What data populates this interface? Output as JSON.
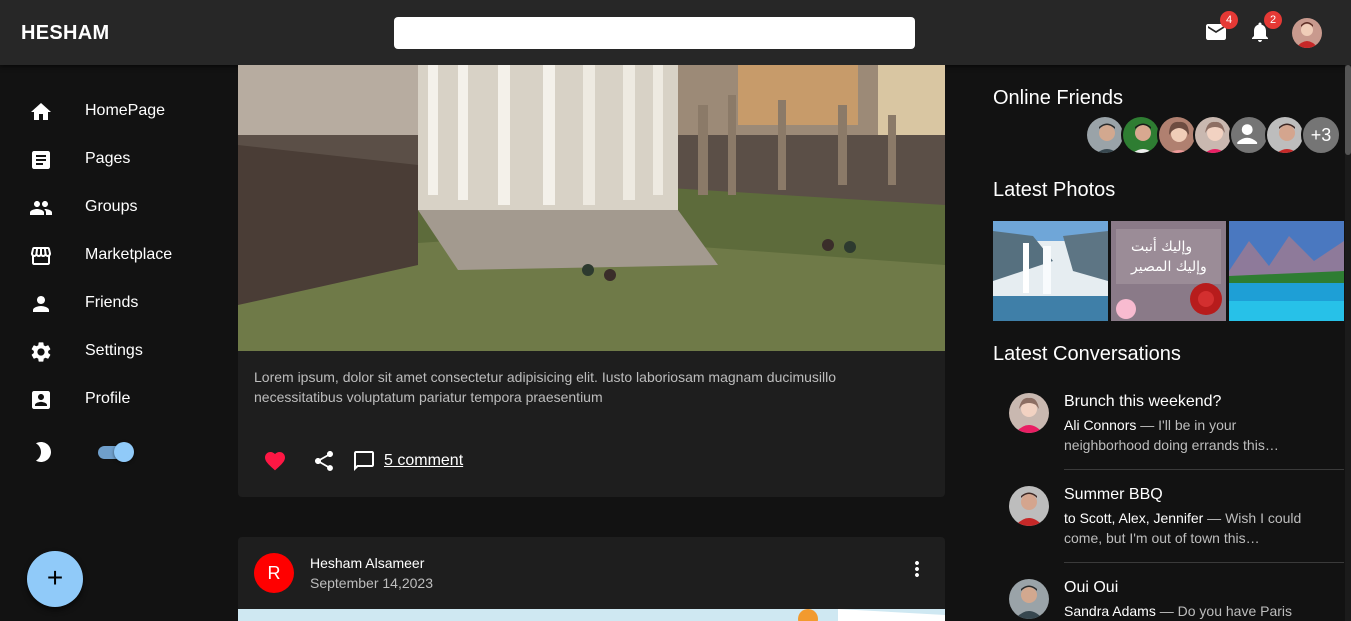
{
  "appbar": {
    "brand": "HESHAM",
    "search": {
      "value": "",
      "placeholder": ""
    },
    "mail_badge": "4",
    "notifications_badge": "2"
  },
  "sidebar": {
    "items": [
      {
        "label": "HomePage",
        "icon": "home-icon"
      },
      {
        "label": "Pages",
        "icon": "article-icon"
      },
      {
        "label": "Groups",
        "icon": "group-icon"
      },
      {
        "label": "Marketplace",
        "icon": "storefront-icon"
      },
      {
        "label": "Friends",
        "icon": "person-icon"
      },
      {
        "label": "Settings",
        "icon": "settings-icon"
      },
      {
        "label": "Profile",
        "icon": "account-box-icon"
      }
    ],
    "dark_mode": true,
    "fab_label": "+"
  },
  "feed": {
    "post1": {
      "text": "Lorem ipsum, dolor sit amet consectetur adipisicing elit. Iusto laboriosam magnam ducimusillo necessitatibus voluptatum pariatur tempora praesentium",
      "comment_link": "5 comment"
    },
    "post2": {
      "avatar_letter": "R",
      "author": "Hesham Alsameer",
      "date": "September 14,2023"
    }
  },
  "right": {
    "online_title": "Online Friends",
    "online_more": "+3",
    "photos_title": "Latest Photos",
    "conversations_title": "Latest Conversations",
    "conversations": [
      {
        "title": "Brunch this weekend?",
        "from": "Ali Connors",
        "snippet": " — I'll be in your neighborhood doing errands this…"
      },
      {
        "title": "Summer BBQ",
        "from": "to Scott, Alex, Jennifer",
        "snippet": " — Wish I could come, but I'm out of town this…"
      },
      {
        "title": "Oui Oui",
        "from": "Sandra Adams",
        "snippet": " — Do you have Paris"
      }
    ]
  },
  "colors": {
    "appbar": "#272727",
    "background": "#121212",
    "card": "#1e1e1e",
    "accent": "#90caf9",
    "badge": "#e53935",
    "heart": "#ff1744"
  }
}
